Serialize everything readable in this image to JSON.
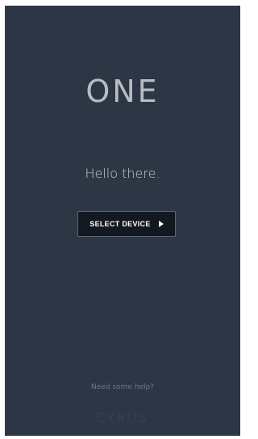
{
  "app": {
    "logo_text": "ONE",
    "greeting": "Hello there.",
    "brand_text": "CYRUS"
  },
  "actions": {
    "select_device_label": "SELECT DEVICE",
    "select_device_icon": "play-arrow-icon",
    "help_link": "Need some help?"
  },
  "colors": {
    "background": "#2d3645",
    "button_background": "#131822",
    "button_border": "#5f6674",
    "logo": "#b9bcc1",
    "greeting": "#c9ccd1",
    "help_link": "#6f7786",
    "brand": "#3f4858"
  }
}
